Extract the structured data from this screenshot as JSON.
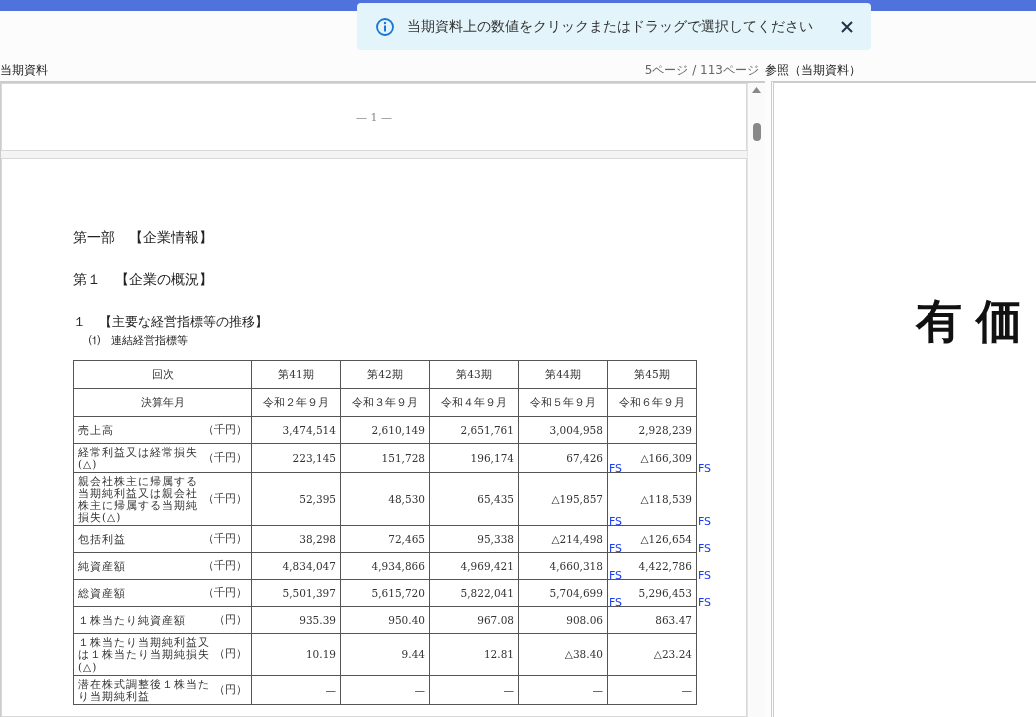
{
  "toast": {
    "message": "当期資料上の数値をクリックまたはドラッグで選択してください"
  },
  "header": {
    "left_title": "当期資料",
    "page_indicator": "5ページ / 113ページ",
    "right_title": "参照（当期資料）"
  },
  "document": {
    "page_number": "— 1 —",
    "headings": [
      {
        "kind": "part",
        "text": "第一部　【企業情報】"
      },
      {
        "kind": "chapter",
        "text": "第１　【企業の概況】"
      },
      {
        "kind": "section",
        "text": "１　【主要な経営指標等の推移】"
      },
      {
        "kind": "subsection",
        "text": "⑴　連結経営指標等"
      }
    ],
    "table": {
      "header_rows": [
        {
          "label": "回次",
          "cells": [
            "第41期",
            "第42期",
            "第43期",
            "第44期",
            "第45期"
          ]
        },
        {
          "label": "決算年月",
          "cells": [
            "令和２年９月",
            "令和３年９月",
            "令和４年９月",
            "令和５年９月",
            "令和６年９月"
          ]
        }
      ],
      "rows": [
        {
          "label": "売上高",
          "unit": "（千円）",
          "cells": [
            {
              "value": "3,474,514"
            },
            {
              "value": "2,610,149"
            },
            {
              "value": "2,651,761"
            },
            {
              "value": "3,004,958"
            },
            {
              "value": "2,928,239"
            }
          ]
        },
        {
          "label": "経常利益又は経常損失(△)",
          "unit": "（千円）",
          "cells": [
            {
              "value": "223,145"
            },
            {
              "value": "151,728"
            },
            {
              "value": "196,174"
            },
            {
              "value": "67,426",
              "tag": "FS"
            },
            {
              "value": "△166,309",
              "tag": "FS"
            }
          ]
        },
        {
          "label": "親会社株主に帰属する当期純利益又は親会社株主に帰属する当期純損失(△)",
          "unit": "（千円）",
          "cells": [
            {
              "value": "52,395"
            },
            {
              "value": "48,530"
            },
            {
              "value": "65,435"
            },
            {
              "value": "△195,857",
              "tag": "FS"
            },
            {
              "value": "△118,539",
              "tag": "FS"
            }
          ]
        },
        {
          "label": "包括利益",
          "unit": "（千円）",
          "cells": [
            {
              "value": "38,298"
            },
            {
              "value": "72,465"
            },
            {
              "value": "95,338"
            },
            {
              "value": "△214,498",
              "tag": "FS"
            },
            {
              "value": "△126,654",
              "tag": "FS"
            }
          ]
        },
        {
          "label": "純資産額",
          "unit": "（千円）",
          "cells": [
            {
              "value": "4,834,047"
            },
            {
              "value": "4,934,866"
            },
            {
              "value": "4,969,421"
            },
            {
              "value": "4,660,318",
              "tag": "FS"
            },
            {
              "value": "4,422,786",
              "tag": "FS"
            }
          ]
        },
        {
          "label": "総資産額",
          "unit": "（千円）",
          "cells": [
            {
              "value": "5,501,397"
            },
            {
              "value": "5,615,720"
            },
            {
              "value": "5,822,041"
            },
            {
              "value": "5,704,699",
              "tag": "FS"
            },
            {
              "value": "5,296,453",
              "tag": "FS"
            }
          ]
        },
        {
          "label": "１株当たり純資産額",
          "unit": "（円）",
          "cells": [
            {
              "value": "935.39"
            },
            {
              "value": "950.40"
            },
            {
              "value": "967.08"
            },
            {
              "value": "908.06"
            },
            {
              "value": "863.47"
            }
          ]
        },
        {
          "label": "１株当たり当期純利益又は１株当たり当期純損失(△)",
          "unit": "（円）",
          "cells": [
            {
              "value": "10.19"
            },
            {
              "value": "9.44"
            },
            {
              "value": "12.81"
            },
            {
              "value": "△38.40"
            },
            {
              "value": "△23.24"
            }
          ]
        },
        {
          "label": "潜在株式調整後１株当たり当期純利益",
          "unit": "（円）",
          "cells": [
            {
              "value": "—"
            },
            {
              "value": "—"
            },
            {
              "value": "—"
            },
            {
              "value": "—"
            },
            {
              "value": "—"
            }
          ]
        }
      ]
    }
  },
  "reference": {
    "cover_title": "有価"
  }
}
